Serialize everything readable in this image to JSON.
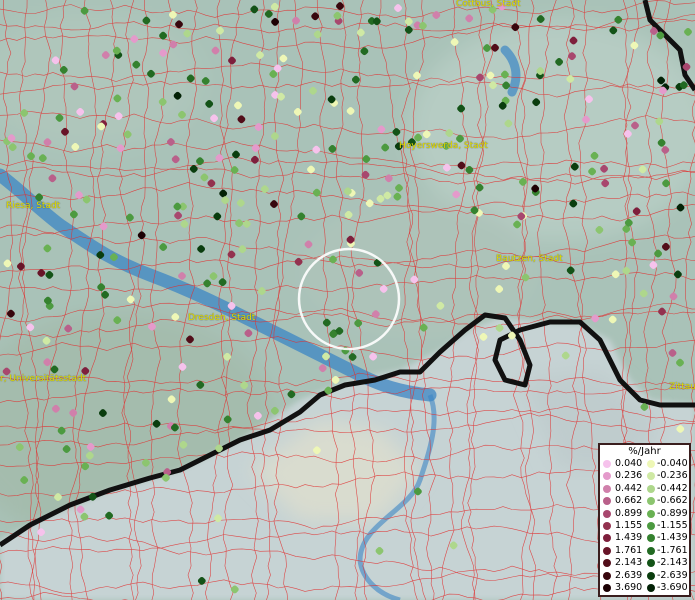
{
  "cities": [
    {
      "id": "cottbus",
      "label": "Cottbus, Stadt"
    },
    {
      "id": "riesa",
      "label": "Riesa, Stadt"
    },
    {
      "id": "hoyerswerda",
      "label": "Hoyerswerda, Stadt"
    },
    {
      "id": "bautzen",
      "label": "Bautzen, Stadt"
    },
    {
      "id": "dresden",
      "label": "Dresden, Stadt"
    },
    {
      "id": "universitaetsstadt",
      "label": "r, Universitätsstadt"
    },
    {
      "id": "zittau",
      "label": "Zittau"
    }
  ],
  "legend": {
    "title": "%/Jahr",
    "positive": [
      {
        "value": "0.040",
        "color": "#f6c2ec"
      },
      {
        "value": "0.236",
        "color": "#e49acb"
      },
      {
        "value": "0.442",
        "color": "#d080ab"
      },
      {
        "value": "0.662",
        "color": "#b9608a"
      },
      {
        "value": "0.899",
        "color": "#a8476e"
      },
      {
        "value": "1.155",
        "color": "#93324f"
      },
      {
        "value": "1.439",
        "color": "#7e1f3c"
      },
      {
        "value": "1.761",
        "color": "#681428"
      },
      {
        "value": "2.143",
        "color": "#520d19"
      },
      {
        "value": "2.639",
        "color": "#38060d"
      },
      {
        "value": "3.690",
        "color": "#1c0104"
      }
    ],
    "negative": [
      {
        "value": "-0.040",
        "color": "#eef7b6"
      },
      {
        "value": "-0.236",
        "color": "#cfe9a4"
      },
      {
        "value": "-0.442",
        "color": "#aed78c"
      },
      {
        "value": "-0.662",
        "color": "#8cc56f"
      },
      {
        "value": "-0.899",
        "color": "#69b153"
      },
      {
        "value": "-1.155",
        "color": "#4c9a40"
      },
      {
        "value": "-1.439",
        "color": "#35822f"
      },
      {
        "value": "-1.761",
        "color": "#226a22"
      },
      {
        "value": "-2.143",
        "color": "#135317"
      },
      {
        "value": "-2.639",
        "color": "#0a3d0e"
      },
      {
        "value": "-3.690",
        "color": "#032206"
      }
    ]
  },
  "colors": {
    "background": "#a9c2b8",
    "admin_border": "#e03030",
    "country_border": "#000000",
    "river": "#3c86c4",
    "city_label": "#e4e000"
  }
}
